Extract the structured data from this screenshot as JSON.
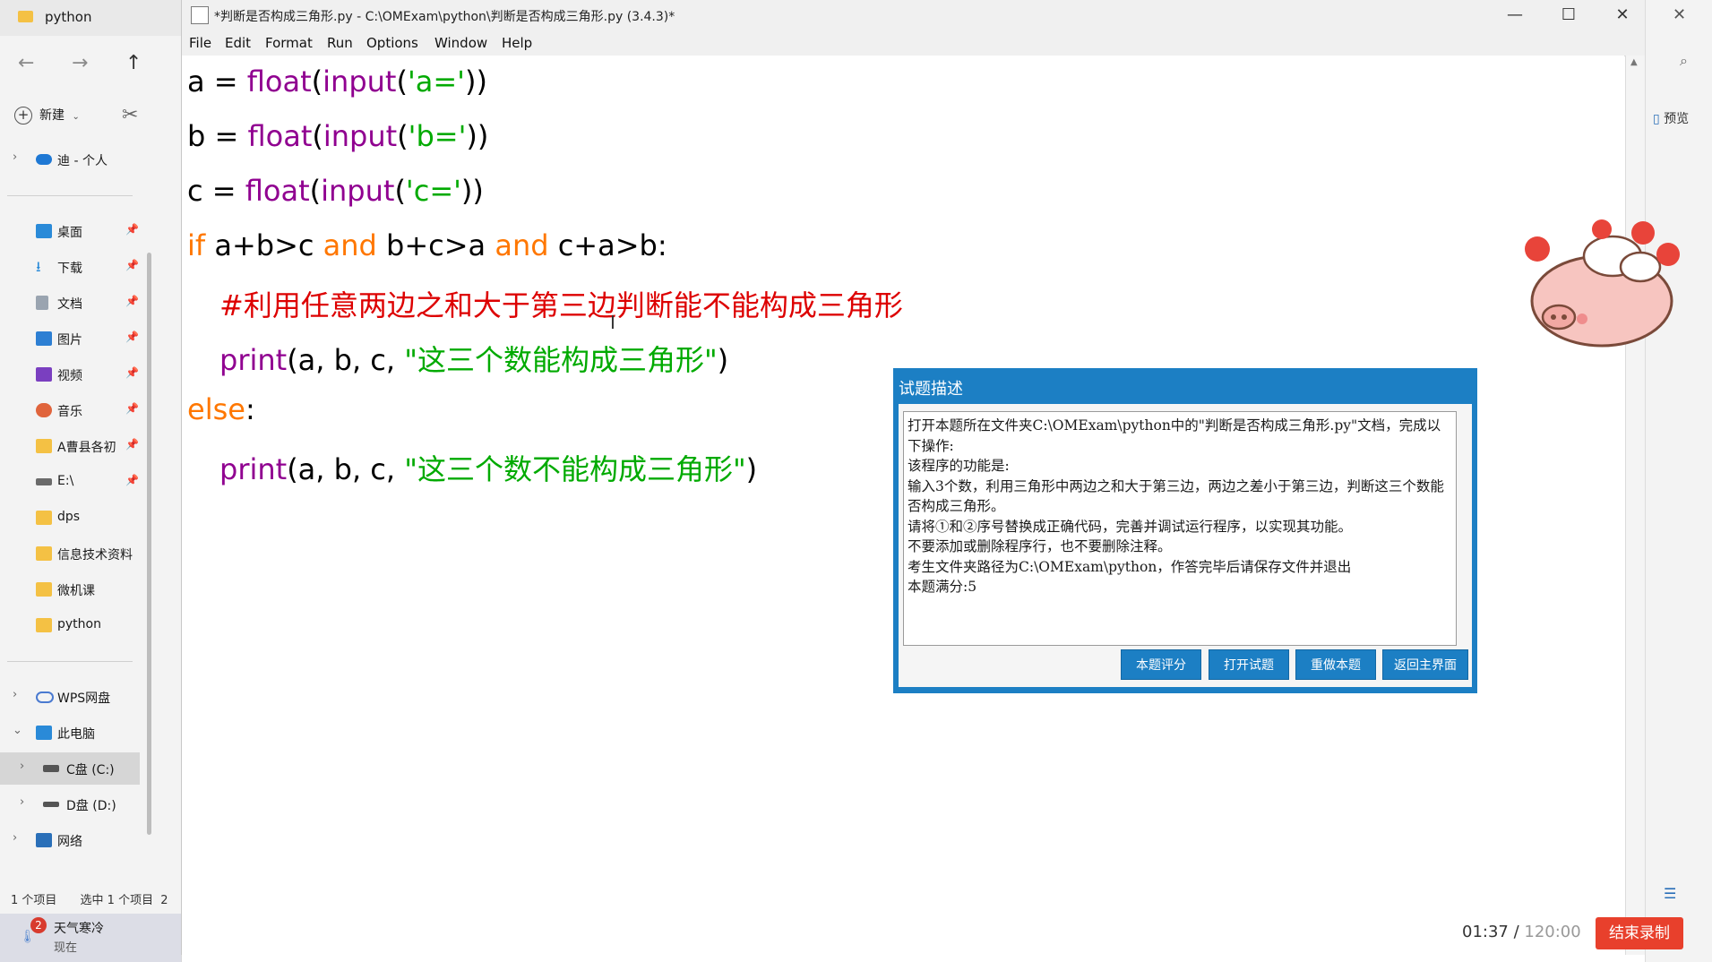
{
  "explorer": {
    "tab_title": "python",
    "new_button": "新建",
    "nav_items": [
      {
        "label": "迪 - 个人",
        "icon": "cloud-icon"
      },
      {
        "label": "桌面",
        "icon": "desktop-icon"
      },
      {
        "label": "下载",
        "icon": "download-icon"
      },
      {
        "label": "文档",
        "icon": "document-icon"
      },
      {
        "label": "图片",
        "icon": "picture-icon"
      },
      {
        "label": "视频",
        "icon": "video-icon"
      },
      {
        "label": "音乐",
        "icon": "music-icon"
      },
      {
        "label": "A曹县各初",
        "icon": "folder-icon"
      },
      {
        "label": "E:\\",
        "icon": "drive-icon"
      },
      {
        "label": "dps",
        "icon": "folder-icon"
      },
      {
        "label": "信息技术资料",
        "icon": "folder-icon"
      },
      {
        "label": "微机课",
        "icon": "folder-icon"
      },
      {
        "label": "python",
        "icon": "folder-icon"
      },
      {
        "label": "WPS网盘",
        "icon": "cloud-drive-icon"
      },
      {
        "label": "此电脑",
        "icon": "computer-icon"
      },
      {
        "label": "C盘 (C:)",
        "icon": "drive-icon"
      },
      {
        "label": "D盘 (D:)",
        "icon": "drive-icon"
      },
      {
        "label": "网络",
        "icon": "network-icon"
      }
    ],
    "status_items": "1 个项目",
    "status_selected": "选中 1 个项目",
    "status_extra": "2",
    "weather_badge": "2",
    "weather_title": "天气寒冷",
    "weather_sub": "现在"
  },
  "idle": {
    "title": "*判断是否构成三角形.py - C:\\OMExam\\python\\判断是否构成三角形.py (3.4.3)*",
    "menu": [
      "File",
      "Edit",
      "Format",
      "Run",
      "Options",
      "Window",
      "Help"
    ],
    "code": {
      "l1": {
        "var": "a = ",
        "f1": "float",
        "p1": "(",
        "f2": "input",
        "p2": "(",
        "s": "'a='",
        "p3": "))"
      },
      "l2": {
        "var": "b = ",
        "f1": "float",
        "p1": "(",
        "f2": "input",
        "p2": "(",
        "s": "'b='",
        "p3": "))"
      },
      "l3": {
        "var": "c = ",
        "f1": "float",
        "p1": "(",
        "f2": "input",
        "p2": "(",
        "s": "'c='",
        "p3": "))"
      },
      "l4": {
        "k1": "if",
        "t1": " a+b>c ",
        "k2": "and",
        "t2": " b+c>a ",
        "k3": "and",
        "t3": " c+a>b:"
      },
      "l5": {
        "comment": "#利用任意两边之和大于第三边判断能不能构成三角形"
      },
      "l6": {
        "f": "print",
        "t": "(a, b, c, ",
        "s": "\"这三个数能构成三角形\"",
        "e": ")"
      },
      "l7": {
        "k": "else",
        "t": ":"
      },
      "l8": {
        "f": "print",
        "t": "(a, b, c, ",
        "s": "\"这三个数不能构成三角形\"",
        "e": ")"
      }
    }
  },
  "dialog": {
    "title": "试题描述",
    "lines": [
      "打开本题所在文件夹C:\\OMExam\\python中的\"判断是否构成三角形.py\"文档，完成以下操作:",
      "该程序的功能是:",
      "输入3个数，利用三角形中两边之和大于第三边，两边之差小于第三边，判断这三个数能否构成三角形。",
      "请将①和②序号替换成正确代码，完善并调试运行程序，以实现其功能。",
      "不要添加或删除程序行，也不要删除注释。",
      "考生文件夹路径为C:\\OMExam\\python，作答完毕后请保存文件并退出",
      "本题满分:5"
    ],
    "buttons": [
      "本题评分",
      "打开试题",
      "重做本题",
      "返回主界面"
    ]
  },
  "right": {
    "preview_label": "预览"
  },
  "recorder": {
    "elapsed": "01:37",
    "separator": " / ",
    "total": "120:00",
    "stop_label": "结束录制"
  },
  "colors": {
    "keyword": "#ff7700",
    "builtin": "#900090",
    "string": "#00aa00",
    "comment": "#dd0000",
    "dialog": "#1c7fc4",
    "stop": "#e8402c"
  }
}
